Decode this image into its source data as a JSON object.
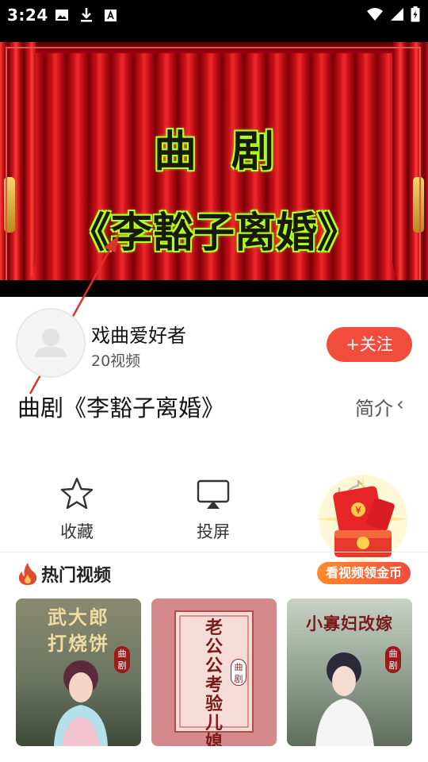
{
  "status_bar": {
    "time": "3:24"
  },
  "video": {
    "title": "曲剧",
    "subtitle": "《李豁子离婚》"
  },
  "author": {
    "name": "戏曲爱好者",
    "video_count": "20视频",
    "follow_label": "+关注"
  },
  "video_info": {
    "title": "曲剧《李豁子离婚》",
    "intro_label": "简介",
    "intro_chevron": "‹"
  },
  "actions": [
    {
      "label": "收藏",
      "icon": "star-icon"
    },
    {
      "label": "投屏",
      "icon": "cast-icon"
    },
    {
      "label": "",
      "icon": "share-icon"
    }
  ],
  "promo": {
    "label": "看视频领金币",
    "icon": "red-packet-icon"
  },
  "hot": {
    "title": "热门视频",
    "icon": "flame-icon",
    "items": [
      {
        "thumb_title": "武大郎打烧饼",
        "badge": "曲剧"
      },
      {
        "thumb_title": "老公公考验儿媳妇",
        "badge": "曲剧"
      },
      {
        "thumb_title": "小寡妇改嫁",
        "badge": "曲剧"
      }
    ]
  },
  "colors": {
    "accent": "#f24c3d",
    "curtain": "#c8101b",
    "title_glow": "#b6ff3a"
  }
}
